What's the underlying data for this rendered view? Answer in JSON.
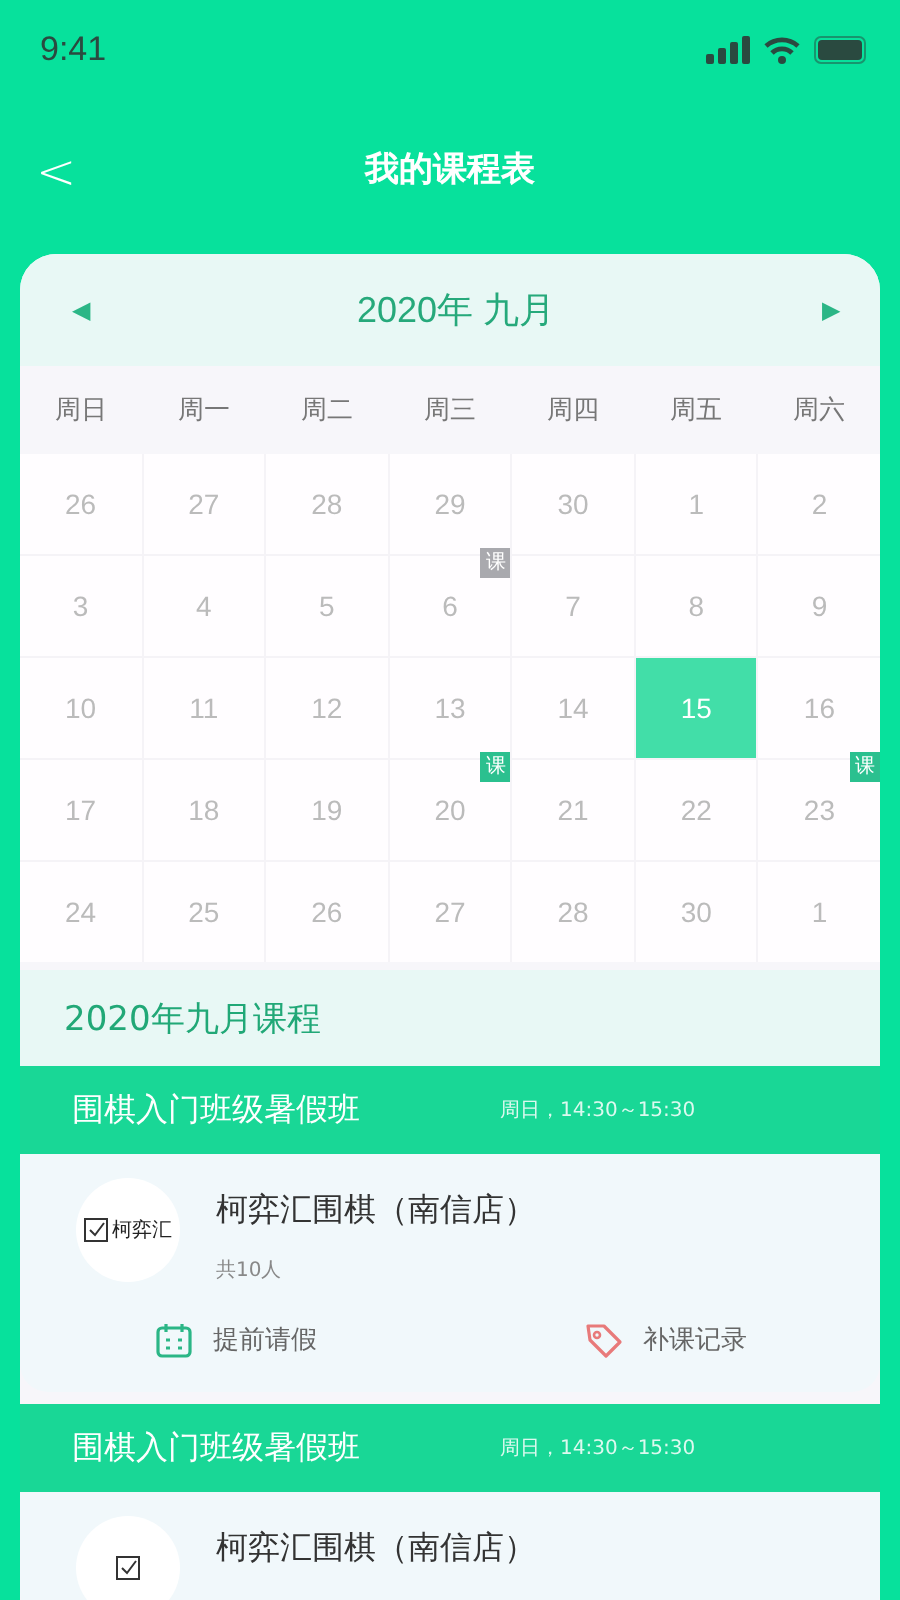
{
  "status_bar": {
    "time": "9:41"
  },
  "header": {
    "back": "<",
    "title": "我的课程表"
  },
  "calendar": {
    "month_title": "2020年 九月",
    "prev": "◀",
    "next": "▶",
    "weekdays": [
      "周日",
      "周一",
      "周二",
      "周三",
      "周四",
      "周五",
      "周六"
    ],
    "weeks": [
      [
        {
          "day": "26",
          "selected": false
        },
        {
          "day": "27",
          "selected": false
        },
        {
          "day": "28",
          "selected": false
        },
        {
          "day": "29",
          "selected": false
        },
        {
          "day": "30",
          "selected": false
        },
        {
          "day": "1",
          "selected": false
        },
        {
          "day": "2",
          "selected": false
        }
      ],
      [
        {
          "day": "3",
          "selected": false
        },
        {
          "day": "4",
          "selected": false
        },
        {
          "day": "5",
          "selected": false
        },
        {
          "day": "6",
          "selected": false,
          "badge": {
            "text": "课",
            "color": "#a9a9ae"
          }
        },
        {
          "day": "7",
          "selected": false
        },
        {
          "day": "8",
          "selected": false
        },
        {
          "day": "9",
          "selected": false
        }
      ],
      [
        {
          "day": "10",
          "selected": false
        },
        {
          "day": "11",
          "selected": false
        },
        {
          "day": "12",
          "selected": false
        },
        {
          "day": "13",
          "selected": false
        },
        {
          "day": "14",
          "selected": false
        },
        {
          "day": "15",
          "selected": true
        },
        {
          "day": "16",
          "selected": false
        }
      ],
      [
        {
          "day": "17",
          "selected": false
        },
        {
          "day": "18",
          "selected": false
        },
        {
          "day": "19",
          "selected": false
        },
        {
          "day": "20",
          "selected": false,
          "badge": {
            "text": "课",
            "color": "#2bc08f"
          }
        },
        {
          "day": "21",
          "selected": false
        },
        {
          "day": "22",
          "selected": false
        },
        {
          "day": "23",
          "selected": false,
          "badge": {
            "text": "课",
            "color": "#2bc08f"
          }
        }
      ],
      [
        {
          "day": "24",
          "selected": false
        },
        {
          "day": "25",
          "selected": false
        },
        {
          "day": "26",
          "selected": false
        },
        {
          "day": "27",
          "selected": false
        },
        {
          "day": "28",
          "selected": false
        },
        {
          "day": "30",
          "selected": false
        },
        {
          "day": "1",
          "selected": false
        }
      ]
    ]
  },
  "section_title": "2020年九月课程",
  "courses": [
    {
      "class_name": "围棋入门班级暑假班",
      "schedule": "周日，14:30～15:30",
      "school": "柯弈汇围棋（南信店）",
      "logo_text": "柯弈汇",
      "count": "共10人",
      "actions": [
        {
          "kind": "leave",
          "label": "提前请假"
        },
        {
          "kind": "makeup",
          "label": "补课记录"
        }
      ]
    },
    {
      "class_name": "围棋入门班级暑假班",
      "schedule": "周日，14:30～15:30",
      "school": "柯弈汇围棋（南信店）"
    }
  ]
}
